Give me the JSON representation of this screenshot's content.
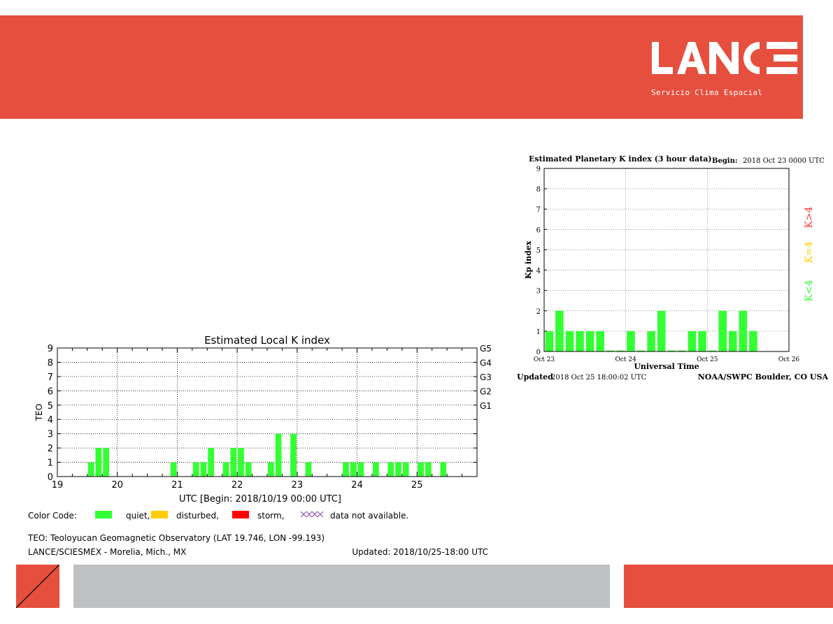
{
  "header": {
    "logo_text": "LANCE",
    "logo_subtitle": "Servicio Clima Espacial",
    "brand_color": "#e64f3e"
  },
  "footer": {
    "gray_color": "#bdc1c3"
  },
  "chart_data": [
    {
      "type": "bar",
      "title": "Estimated Local K index",
      "ylabel": "TEO",
      "xlabel": "UTC [Begin: 2018/10/19 00:00 UTC]",
      "ylim": [
        0,
        9
      ],
      "grid": true,
      "x_tick_labels": [
        "19",
        "20",
        "21",
        "22",
        "23",
        "24",
        "25"
      ],
      "y_tick_labels": [
        "0",
        "1",
        "2",
        "3",
        "4",
        "5",
        "6",
        "7",
        "8",
        "9"
      ],
      "g_scale_labels": [
        {
          "label": "G5",
          "k": 9
        },
        {
          "label": "G4",
          "k": 8
        },
        {
          "label": "G3",
          "k": 7
        },
        {
          "label": "G2",
          "k": 6
        },
        {
          "label": "G1",
          "k": 5
        }
      ],
      "x_day_start": 19,
      "x_day_end": 26,
      "bars_per_day": 8,
      "values": [
        0,
        0,
        0,
        0,
        1,
        2,
        2,
        0,
        0,
        0,
        0,
        0,
        0,
        0,
        0,
        1,
        0,
        0,
        1,
        1,
        2,
        0,
        1,
        2,
        2,
        1,
        0,
        0,
        1,
        3,
        0,
        3,
        0,
        1,
        0,
        0,
        0,
        0,
        1,
        1,
        1,
        0,
        1,
        0,
        1,
        1,
        1,
        0,
        1,
        1,
        0,
        1,
        0,
        0,
        0,
        0
      ],
      "missing_start_index": 56,
      "legend": {
        "prefix": "Color Code:",
        "items": [
          {
            "label": "quiet,",
            "color": "#33ff33"
          },
          {
            "label": "disturbed,",
            "color": "#ffcc00"
          },
          {
            "label": "storm,",
            "color": "#ff0000"
          }
        ],
        "missing": {
          "label": "data not available.",
          "color": "#8844aa"
        }
      },
      "footer_station": "TEO: Teoloyucan Geomagnetic Observatory (LAT  19.746, LON -99.193)",
      "footer_source": "LANCE/SCIESMEX - Morelia, Mich., MX",
      "footer_updated": "Updated: 2018/10/25-18:00 UTC"
    },
    {
      "type": "bar",
      "title": "Estimated Planetary K index (3 hour data)",
      "begin_label": "Begin:",
      "begin_value": "2018 Oct 23 0000 UTC",
      "ylabel": "Kp index",
      "xlabel": "Universal Time",
      "ylim": [
        0,
        9
      ],
      "grid": true,
      "x_tick_labels": [
        "Oct 23",
        "Oct 24",
        "Oct 25",
        "Oct 26"
      ],
      "y_tick_labels": [
        "0",
        "1",
        "2",
        "3",
        "4",
        "5",
        "6",
        "7",
        "8",
        "9"
      ],
      "values": [
        1,
        2,
        1,
        1,
        1,
        1,
        0.05,
        0.05,
        1,
        0.05,
        1,
        2,
        0.05,
        0.05,
        1,
        1,
        0.05,
        2,
        1,
        2,
        1
      ],
      "bar_color": "#33ff33",
      "side_labels": [
        {
          "label": "K>4",
          "color": "#ff3333"
        },
        {
          "label": "K=4",
          "color": "#ffcc00"
        },
        {
          "label": "K<4",
          "color": "#33ff33"
        }
      ],
      "updated_prefix": "Updated",
      "updated_value": "2018 Oct 25 18:00:02 UTC",
      "credit": "NOAA/SWPC Boulder, CO USA"
    }
  ]
}
